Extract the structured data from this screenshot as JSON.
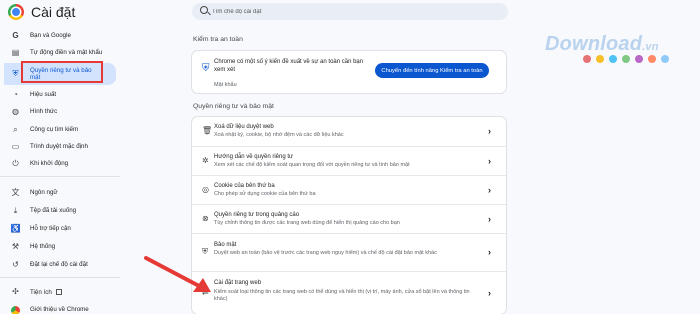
{
  "app": {
    "title": "Cài đặt"
  },
  "search": {
    "placeholder": "Tìm chế độ cài đặt"
  },
  "sidebar": {
    "items": [
      {
        "label": "Bạn và Google",
        "icon": "google-icon"
      },
      {
        "label": "Tự động điền và mật khẩu",
        "icon": "clipboard-icon"
      },
      {
        "label": "Quyền riêng tư và bảo mật",
        "icon": "shield-icon",
        "active": true
      },
      {
        "label": "Hiệu suất",
        "icon": "speedometer-icon"
      },
      {
        "label": "Hình thức",
        "icon": "palette-icon"
      },
      {
        "label": "Công cụ tìm kiếm",
        "icon": "search-icon"
      },
      {
        "label": "Trình duyệt mặc định",
        "icon": "browser-icon"
      },
      {
        "label": "Khi khởi động",
        "icon": "power-icon"
      },
      {
        "label": "Ngôn ngữ",
        "icon": "language-icon"
      },
      {
        "label": "Tệp đã tải xuống",
        "icon": "download-icon"
      },
      {
        "label": "Hỗ trợ tiếp cận",
        "icon": "accessibility-icon"
      },
      {
        "label": "Hệ thống",
        "icon": "wrench-icon"
      },
      {
        "label": "Đặt lại chế độ cài đặt",
        "icon": "reset-icon"
      },
      {
        "label": "Tiện ích",
        "icon": "puzzle-icon"
      },
      {
        "label": "Giới thiệu về Chrome",
        "icon": "chrome-icon"
      }
    ]
  },
  "safety_check": {
    "title": "Kiểm tra an toàn",
    "text": "Chrome có một số ý kiến đề xuất về sự an toàn cần bạn xem xét",
    "sub": "Mật khẩu",
    "button": "Chuyển đến tính năng Kiểm tra an toàn"
  },
  "privacy": {
    "title": "Quyền riêng tư và bảo mật",
    "rows": [
      {
        "title": "Xoá dữ liệu duyệt web",
        "desc": "Xoá nhật ký, cookie, bộ nhớ đệm và các dữ liệu khác",
        "icon": "trash-icon"
      },
      {
        "title": "Hướng dẫn về quyền riêng tư",
        "desc": "Xem xét các chế độ kiểm soát quan trọng đối với quyền riêng tư và tính bảo mật",
        "icon": "guide-icon"
      },
      {
        "title": "Cookie của bên thứ ba",
        "desc": "Cho phép sử dụng cookie của bên thứ ba",
        "icon": "cookie-icon"
      },
      {
        "title": "Quyền riêng tư trong quảng cáo",
        "desc": "Tùy chỉnh thông tin được các trang web dùng để hiển thị quảng cáo cho bạn",
        "icon": "ad-privacy-icon"
      },
      {
        "title": "Bảo mật",
        "desc": "Duyệt web an toàn (bảo vệ trước các trang web nguy hiểm) và chế độ cài đặt bảo mật khác",
        "icon": "shield-icon"
      },
      {
        "title": "Cài đặt trang web",
        "desc": "Kiểm soát loại thông tin các trang web có thể dùng và hiển thị (vị trí, máy ảnh, cửa sổ bật lên và thông tin khác)",
        "icon": "tune-icon"
      }
    ]
  },
  "watermark": {
    "main": "Download",
    "suffix": ".vn"
  },
  "colors": {
    "accent": "#0b57d0",
    "active_bg": "#d3e3fd",
    "highlight": "#e53935",
    "dots": [
      "#e57373",
      "#f6bf26",
      "#4fc3f7",
      "#81c784",
      "#ba68c8",
      "#ff8a65",
      "#90caf9"
    ]
  }
}
